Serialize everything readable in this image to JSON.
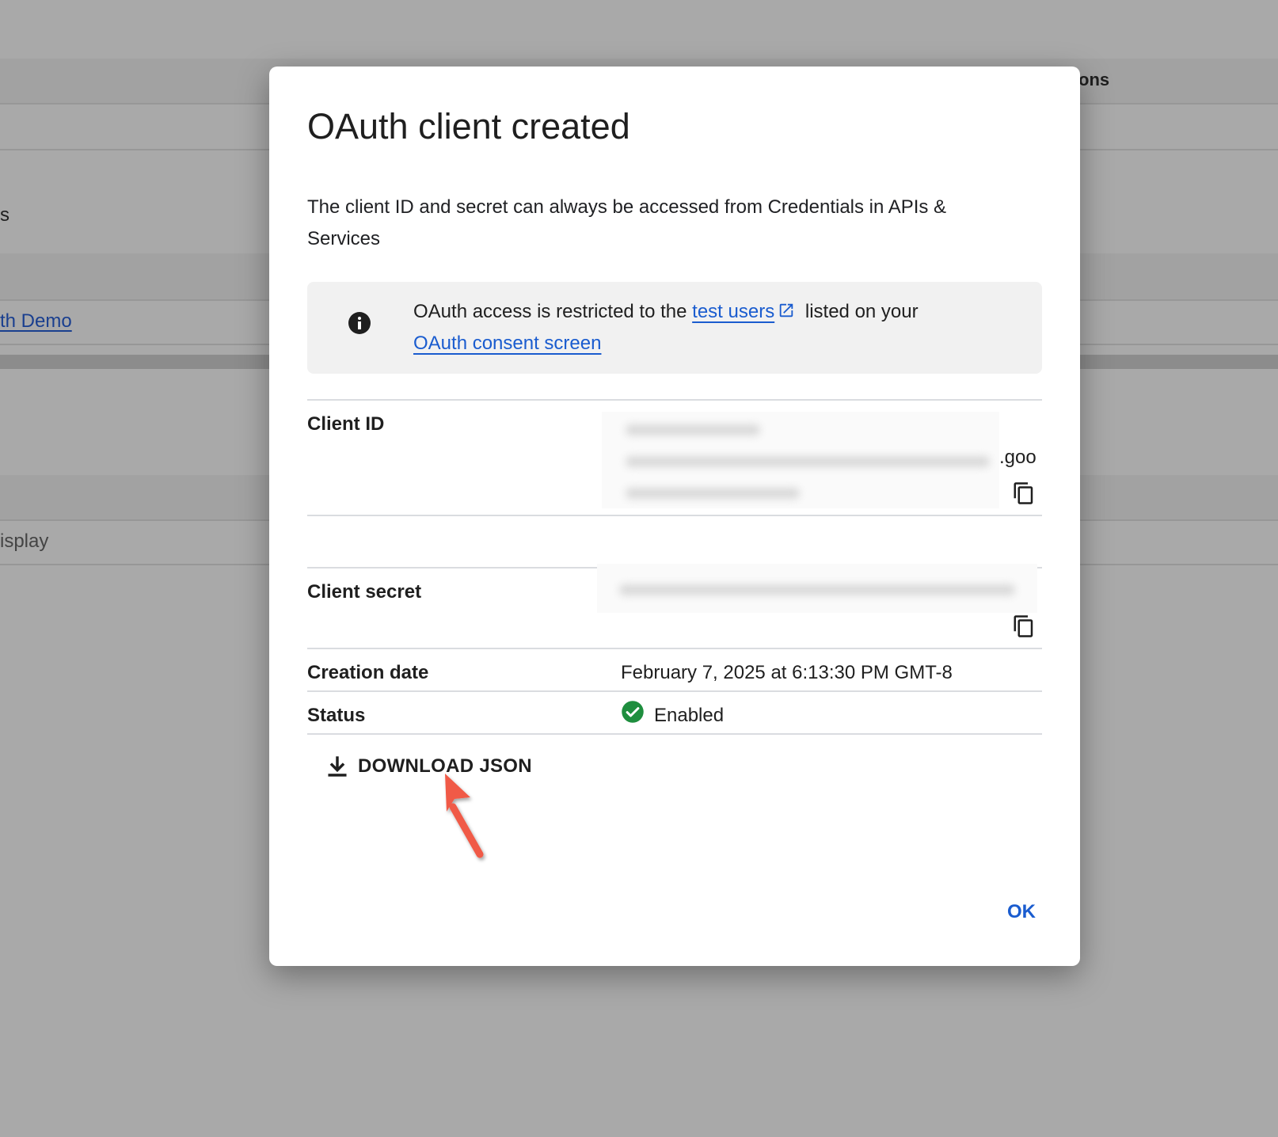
{
  "background": {
    "header_fragment": "ons",
    "row_fragment_s": "s",
    "link_fragment": "th Demo",
    "display_fragment": "isplay"
  },
  "dialog": {
    "title": "OAuth client created",
    "description": "The client ID and secret can always be accessed from Credentials in APIs & Services",
    "info": {
      "prefix": "OAuth access is restricted to the ",
      "test_users_link": "test users",
      "middle": " listed on your ",
      "consent_link": "OAuth consent screen",
      "icon": "info-icon"
    },
    "client_id": {
      "label": "Client ID",
      "visible_suffix": ".goo"
    },
    "client_secret": {
      "label": "Client secret"
    },
    "creation_date": {
      "label": "Creation date",
      "value": "February 7, 2025 at 6:13:30 PM GMT-8"
    },
    "status": {
      "label": "Status",
      "value": "Enabled",
      "color": "#1e8e3e"
    },
    "download_button": "DOWNLOAD JSON",
    "ok_button": "OK",
    "accent_color": "#1a5ccf",
    "annotation_arrow_color": "#f05a46"
  }
}
